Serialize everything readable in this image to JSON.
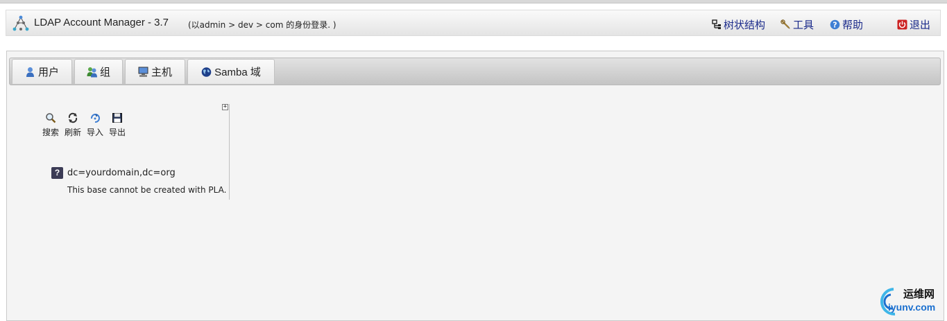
{
  "app": {
    "title": "LDAP Account Manager - 3.7",
    "login_info": "(以admin > dev > com 的身份登录. )"
  },
  "header_links": [
    {
      "label": "树状结构",
      "icon": "tree-icon"
    },
    {
      "label": "工具",
      "icon": "wrench-icon"
    },
    {
      "label": "帮助",
      "icon": "help-icon"
    },
    {
      "label": "退出",
      "icon": "power-icon"
    }
  ],
  "tabs": [
    {
      "label": "用户",
      "icon": "user-icon"
    },
    {
      "label": "组",
      "icon": "group-icon"
    },
    {
      "label": "主机",
      "icon": "computer-icon"
    },
    {
      "label": "Samba 域",
      "icon": "globe-icon"
    }
  ],
  "tree_toolbar": [
    {
      "label": "搜索",
      "icon": "magnifier-icon"
    },
    {
      "label": "刷新",
      "icon": "refresh-icon"
    },
    {
      "label": "导入",
      "icon": "import-icon"
    },
    {
      "label": "导出",
      "icon": "floppy-icon"
    }
  ],
  "tree": {
    "expand_symbol": "+",
    "entry_icon": "?",
    "entry_dn": "dc=yourdomain,dc=org",
    "entry_note": "This base cannot be created with PLA."
  },
  "watermark": {
    "line1": "运维网",
    "line2": "iyunv.com"
  },
  "colors": {
    "link": "#1a2a8a",
    "accent_blue": "#1a6fcf",
    "logout_red": "#cc2222"
  }
}
